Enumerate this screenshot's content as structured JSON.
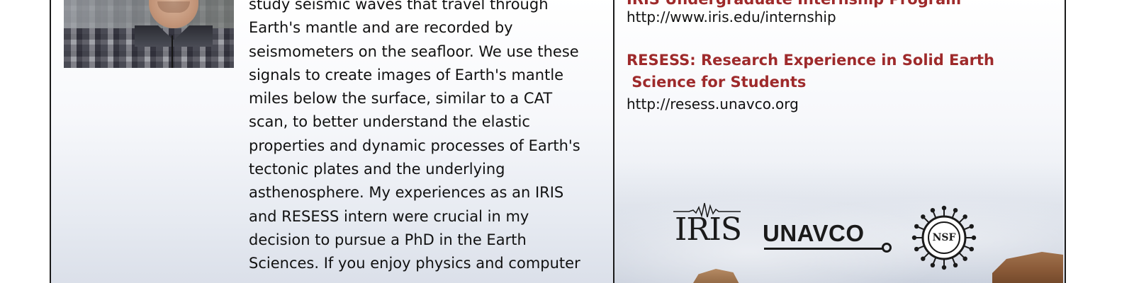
{
  "bio": {
    "lines": [
      "study seismic waves that travel through",
      "Earth's mantle and are recorded by",
      "seismometers on the seafloor. We use these",
      "signals to create images of Earth's mantle",
      "miles below the surface, similar to a CAT",
      "scan, to better understand the elastic",
      "properties and dynamic processes of Earth's",
      "tectonic plates and the underlying",
      "asthenosphere. My experiences as an IRIS",
      "and RESESS intern were crucial in my",
      "decision to pursue a PhD in the Earth",
      "Sciences. If you enjoy physics and computer"
    ]
  },
  "programs": [
    {
      "heading_lines": [
        "IRIS Undergraduate Internship Program"
      ],
      "url": "http://www.iris.edu/internship"
    },
    {
      "heading_lines": [
        "RESESS: Research Experience in Solid Earth",
        " Science for Students"
      ],
      "url": "http://resess.unavco.org"
    }
  ],
  "logos": {
    "iris": "IRIS",
    "unavco": "UNAVCO",
    "nsf": "NSF"
  },
  "colors": {
    "heading": "#9e2a2b",
    "text": "#111111",
    "border": "#1a1a1a"
  },
  "icons": [
    "seismogram-icon",
    "nsf-seal-icon"
  ]
}
